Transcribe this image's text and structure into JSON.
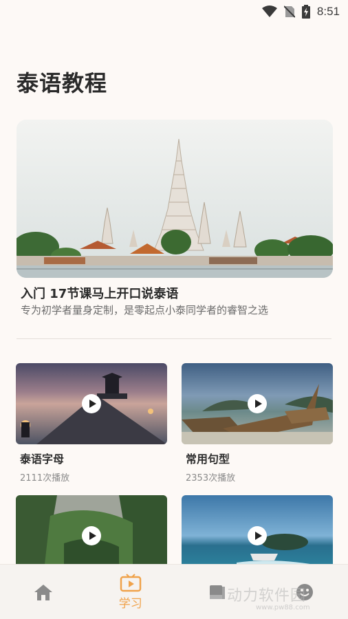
{
  "status_bar": {
    "time": "8:51"
  },
  "page": {
    "title": "泰语教程"
  },
  "hero": {
    "title": "入门 17节课马上开口说泰语",
    "subtitle": "专为初学者量身定制，是零起点小泰同学者的睿智之选"
  },
  "courses": [
    {
      "title": "泰语字母",
      "plays": "2111次播放"
    },
    {
      "title": "常用句型",
      "plays": "2353次播放"
    },
    {
      "title": "",
      "plays": ""
    },
    {
      "title": "",
      "plays": ""
    }
  ],
  "tab_bar": {
    "items": [
      {
        "icon": "home-icon",
        "label": ""
      },
      {
        "icon": "tv-icon",
        "label": "学习",
        "active": true
      },
      {
        "icon": "book-icon",
        "label": ""
      },
      {
        "icon": "smile-icon",
        "label": ""
      }
    ],
    "active_color": "#f0a24a"
  },
  "watermark": {
    "text": "动力软件园",
    "url": "www.pw88.com"
  }
}
